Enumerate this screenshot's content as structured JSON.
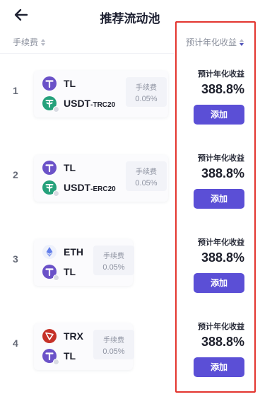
{
  "header": {
    "title": "推荐流动池",
    "back_icon": "arrow-left-icon"
  },
  "sort": {
    "fee_label": "手续费",
    "apy_label": "预计年化收益",
    "apy_sort_color": "#4d4fb8"
  },
  "pools": [
    {
      "rank": "1",
      "coin_a": {
        "name": "TL",
        "sub": "",
        "icon": "tl-token-icon",
        "color": "#6b52c8"
      },
      "coin_b": {
        "name": "USDT",
        "sub": "-TRC20",
        "icon": "usdt-token-icon",
        "color": "#25a17b"
      },
      "fee_label": "手续费",
      "fee_value": "0.05%",
      "apy_label": "预计年化收益",
      "apy_value": "388.8%",
      "add_label": "添加"
    },
    {
      "rank": "2",
      "coin_a": {
        "name": "TL",
        "sub": "",
        "icon": "tl-token-icon",
        "color": "#6b52c8"
      },
      "coin_b": {
        "name": "USDT",
        "sub": "-ERC20",
        "icon": "usdt-token-icon",
        "color": "#25a17b"
      },
      "fee_label": "手续费",
      "fee_value": "0.05%",
      "apy_label": "预计年化收益",
      "apy_value": "388.8%",
      "add_label": "添加"
    },
    {
      "rank": "3",
      "coin_a": {
        "name": "ETH",
        "sub": "",
        "icon": "eth-token-icon",
        "color": "#627eea"
      },
      "coin_b": {
        "name": "TL",
        "sub": "",
        "icon": "tl-token-icon",
        "color": "#6b52c8"
      },
      "fee_label": "手续费",
      "fee_value": "0.05%",
      "apy_label": "预计年化收益",
      "apy_value": "388.8%",
      "add_label": "添加"
    },
    {
      "rank": "4",
      "coin_a": {
        "name": "TRX",
        "sub": "",
        "icon": "trx-token-icon",
        "color": "#c63127"
      },
      "coin_b": {
        "name": "TL",
        "sub": "",
        "icon": "tl-token-icon",
        "color": "#6b52c8"
      },
      "fee_label": "手续费",
      "fee_value": "0.05%",
      "apy_label": "预计年化收益",
      "apy_value": "388.8%",
      "add_label": "添加"
    }
  ],
  "colors": {
    "accent": "#5b4fd6",
    "highlight_border": "#e3352f"
  }
}
